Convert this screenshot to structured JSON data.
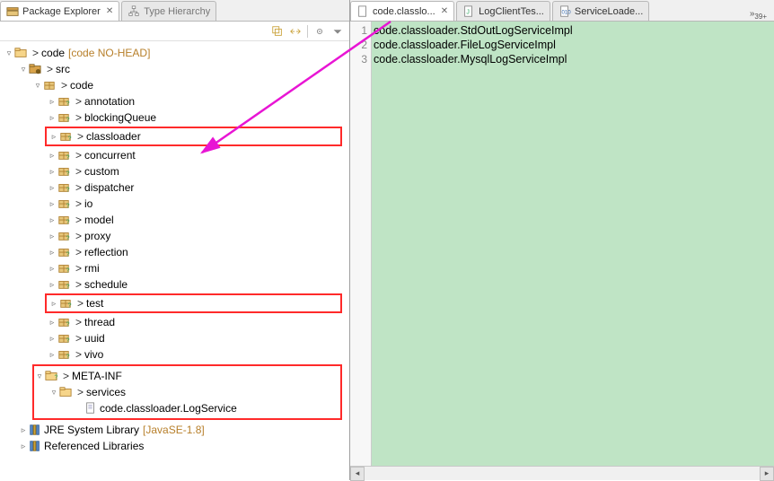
{
  "left": {
    "tabs": [
      {
        "label": "Package Explorer",
        "active": true,
        "closable": true
      },
      {
        "label": "Type Hierarchy",
        "active": false,
        "closable": false
      }
    ],
    "tree": {
      "project": {
        "name": "code",
        "decorator": "[code NO-HEAD]"
      },
      "src": {
        "name": "src"
      },
      "code_pkg": {
        "name": "code"
      },
      "packages": [
        "annotation",
        "blockingQueue",
        "classloader",
        "concurrent",
        "custom",
        "dispatcher",
        "io",
        "model",
        "proxy",
        "reflection",
        "rmi",
        "schedule",
        "test",
        "thread",
        "uuid",
        "vivo"
      ],
      "meta_inf": {
        "name": "META-INF"
      },
      "services": {
        "name": "services"
      },
      "service_file": "code.classloader.LogService",
      "jre": {
        "name": "JRE System Library",
        "decorator": "[JavaSE-1.8]"
      },
      "ref_libs": {
        "name": "Referenced Libraries"
      }
    }
  },
  "right": {
    "tabs": [
      {
        "label": "code.classlo...",
        "active": true
      },
      {
        "label": "LogClientTes...",
        "active": false
      },
      {
        "label": "ServiceLoade...",
        "active": false
      }
    ],
    "overflow": "»",
    "overflow_sub": "39+",
    "lines": [
      "code.classloader.StdOutLogServiceImpl",
      "code.classloader.FileLogServiceImpl",
      "code.classloader.MysqlLogServiceImpl"
    ]
  }
}
